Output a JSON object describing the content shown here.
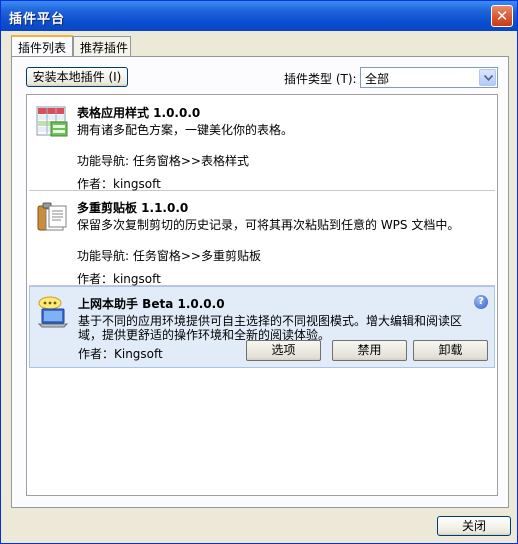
{
  "window": {
    "title": "插件平台",
    "close_glyph": "✕"
  },
  "tabs": [
    {
      "label": "插件列表"
    },
    {
      "label": "推荐插件"
    }
  ],
  "toolbar": {
    "install_label": "安装本地插件 (I)",
    "type_label": "插件类型 (T):",
    "type_value": "全部"
  },
  "plugins": [
    {
      "name": "表格应用样式 1.0.0.0",
      "desc": "拥有诸多配色方案，一键美化你的表格。",
      "nav": "功能导航: 任务窗格>>表格样式",
      "author": "作者：kingsoft",
      "icon": "table-style-icon"
    },
    {
      "name": "多重剪贴板 1.1.0.0",
      "desc": "保留多次复制剪切的历史记录，可将其再次粘贴到任意的 WPS 文档中。",
      "nav": "功能导航: 任务窗格>>多重剪贴板",
      "author": "作者：kingsoft",
      "icon": "clipboard-icon"
    },
    {
      "name": "上网本助手 Beta 1.0.0.0",
      "desc": "基于不同的应用环境提供可自主选择的不同视图模式。增大编辑和阅读区域，提供更舒适的操作环境和全新的阅读体验。",
      "author": "作者：Kingsoft",
      "icon": "netbook-icon",
      "help_glyph": "?",
      "buttons": {
        "options": "选项",
        "disable": "禁用",
        "uninstall": "卸载"
      }
    }
  ],
  "footer": {
    "close_label": "关闭"
  },
  "colors": {
    "titlebar": "#0a4fd1",
    "selected_row": "#e1ecf8",
    "window_bg": "#ece9d8"
  }
}
